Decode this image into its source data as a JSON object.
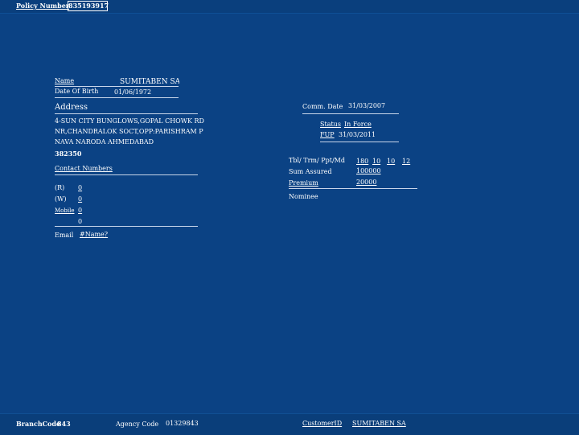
{
  "header": {
    "policy_number_label": "Policy Number",
    "policy_number_value": "835193917"
  },
  "personal": {
    "name_label": "Name",
    "name_value": "SUMITABEN SAN",
    "dob_label": "Date Of Birth",
    "dob_value": "01/06/1972",
    "address_label": "Address",
    "address_lines": [
      "4-SUN CITY BUNGLOWS,GOPAL CHOWK RD",
      "NR,CHANDRALOK SOCT,OPP:PARISHRAM P",
      "NAVA NARODA AHMEDABAD",
      "382350"
    ],
    "contact_label": "Contact Numbers",
    "contacts": [
      {
        "label": "(R)",
        "value": "0"
      },
      {
        "label": "(W)",
        "value": "0"
      },
      {
        "label": "Mobile",
        "value": "0"
      },
      {
        "label": "",
        "value": "0"
      }
    ],
    "email_label": "Email",
    "email_value": "#Name?"
  },
  "policy": {
    "comm_date_label": "Comm. Date",
    "comm_date_value": "31/03/2007",
    "status_label": "Status",
    "status_value": "In Force",
    "fup_label": "FUP",
    "fup_value": "31/03/2011",
    "tbl_label": "Tbl/ Trm/ Ppt/Md",
    "tbl_values": [
      "180",
      "10",
      "10",
      "12"
    ],
    "sum_assured_label": "Sum Assured",
    "sum_assured_value": "100000",
    "premium_label": "Premium",
    "premium_value": "20000",
    "nominee_label": "Nominee"
  },
  "footer": {
    "branch_code_label": "BranchCode",
    "branch_code_value": "843",
    "agency_code_label": "Agency Code",
    "agency_code_value": "01329843",
    "customer_id_label": "CustomerID",
    "customer_id_value": "SUMITABEN SA"
  },
  "colors": {
    "background": "#0b4284",
    "text": "#ffffff"
  }
}
